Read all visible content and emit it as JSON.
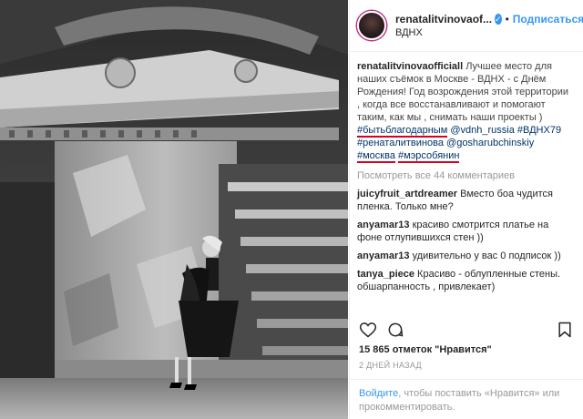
{
  "post": {
    "username": "renatalitvinovaof...",
    "separator": "•",
    "follow_label": "Подписаться",
    "location": "ВДНХ"
  },
  "caption": {
    "username": "renatalitvinovaofficiall",
    "text": "Лучшее место для наших съёмок в Москве - ВДНХ - с Днём Рождения! Год возрождения этой территории , когда все восстанавливают и помогают таким, как мы , снимать наши проекты )",
    "tags": [
      "#бытьблагодарным",
      "@vdnh_russia",
      "#ВДНХ79",
      "#ренаталитвинова",
      "@gosharubchinskiy",
      "#москва",
      "#мэрсобянин"
    ]
  },
  "view_all": "Посмотреть все 44 комментариев",
  "comments": [
    {
      "user": "juicyfruit_artdreamer",
      "text": "Вместо боа чудится пленка. Только мне?"
    },
    {
      "user": "anyamar13",
      "text": "красиво смотрится платье на фоне отлупившихся стен ))"
    },
    {
      "user": "anyamar13",
      "text": "удивительно у вас 0 подписок ))"
    },
    {
      "user": "tanya_piece",
      "text": "Красиво - облупленные стены. обшарпанность , привлекает)"
    }
  ],
  "likes": {
    "count": "15 865",
    "label": "отметок \"Нравится\""
  },
  "date": "2 ДНЕЙ НАЗАД",
  "login": {
    "link": "Войдите",
    "text": ", чтобы поставить «Нравится» или прокомментировать."
  },
  "icons": {
    "verified": "verified-icon",
    "like": "heart-icon",
    "comment": "comment-icon",
    "save": "bookmark-icon"
  },
  "colors": {
    "accent": "#3897f0",
    "tag": "#003569",
    "underline": "#d8001c"
  }
}
